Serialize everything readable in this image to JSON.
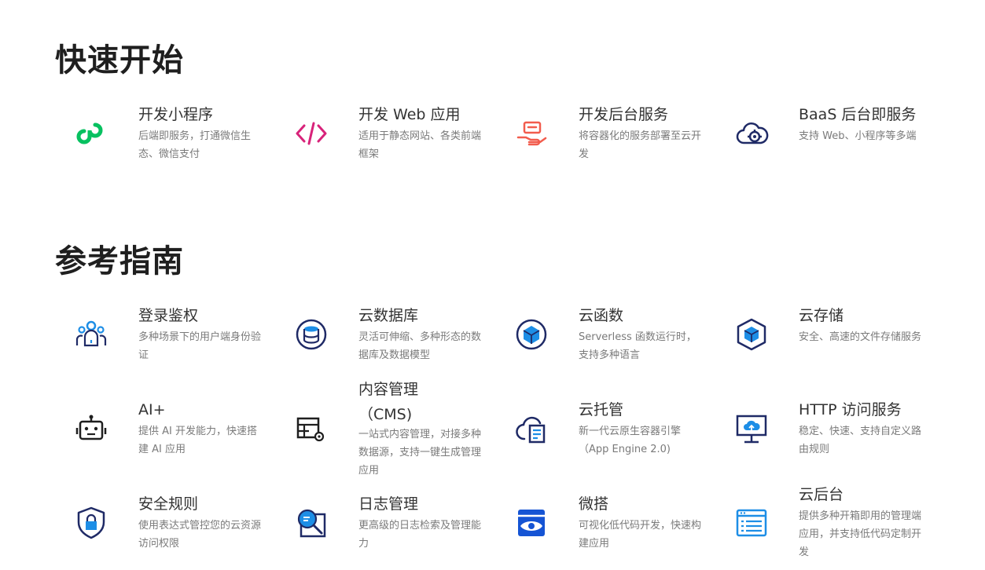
{
  "quick_start": {
    "title": "快速开始",
    "cards": [
      {
        "title": "开发小程序",
        "desc": "后端即服务，打通微信生态、微信支付",
        "icon": "miniprogram-icon"
      },
      {
        "title": "开发 Web 应用",
        "desc": "适用于静态网站、各类前端框架",
        "icon": "code-icon"
      },
      {
        "title": "开发后台服务",
        "desc": "将容器化的服务部署至云开发",
        "icon": "service-hand-icon"
      },
      {
        "title": "BaaS 后台即服务",
        "desc": "支持 Web、小程序等多端",
        "icon": "cloud-gear-icon"
      }
    ]
  },
  "reference": {
    "title": "参考指南",
    "cards": [
      {
        "title": "登录鉴权",
        "desc": "多种场景下的用户端身份验证",
        "icon": "users-icon"
      },
      {
        "title": "云数据库",
        "desc": "灵活可伸缩、多种形态的数据库及数据模型",
        "icon": "database-icon"
      },
      {
        "title": "云函数",
        "desc": "Serverless 函数运行时，支持多种语言",
        "icon": "function-cube-icon"
      },
      {
        "title": "云存储",
        "desc": "安全、高速的文件存储服务",
        "icon": "storage-box-icon"
      },
      {
        "title": "AI+",
        "desc": "提供 AI 开发能力，快速搭建 AI 应用",
        "icon": "robot-icon"
      },
      {
        "title": "内容管理（CMS)",
        "desc": "一站式内容管理，对接多种数据源，支持一键生成管理应用",
        "icon": "table-gear-icon"
      },
      {
        "title": "云托管",
        "desc": "新一代云原生容器引擎（App Engine 2.0)",
        "icon": "cloud-doc-icon"
      },
      {
        "title": "HTTP 访问服务",
        "desc": "稳定、快速、支持自定义路由规则",
        "icon": "monitor-cloud-icon"
      },
      {
        "title": "安全规则",
        "desc": "使用表达式管控您的云资源访问权限",
        "icon": "shield-lock-icon"
      },
      {
        "title": "日志管理",
        "desc": "更高级的日志检索及管理能力",
        "icon": "log-search-icon"
      },
      {
        "title": "微搭",
        "desc": "可视化低代码开发，快速构建应用",
        "icon": "eye-window-icon"
      },
      {
        "title": "云后台",
        "desc": "提供多种开箱即用的管理端应用，并支持低代码定制开发",
        "icon": "browser-list-icon"
      }
    ]
  },
  "colors": {
    "heading": "#1f1f1f",
    "title": "#333333",
    "desc": "#7a7a7a",
    "green": "#07c160",
    "pink": "#d8237a",
    "coral": "#f25c4d",
    "navy": "#1f2a66",
    "blue": "#1d8ee6"
  }
}
